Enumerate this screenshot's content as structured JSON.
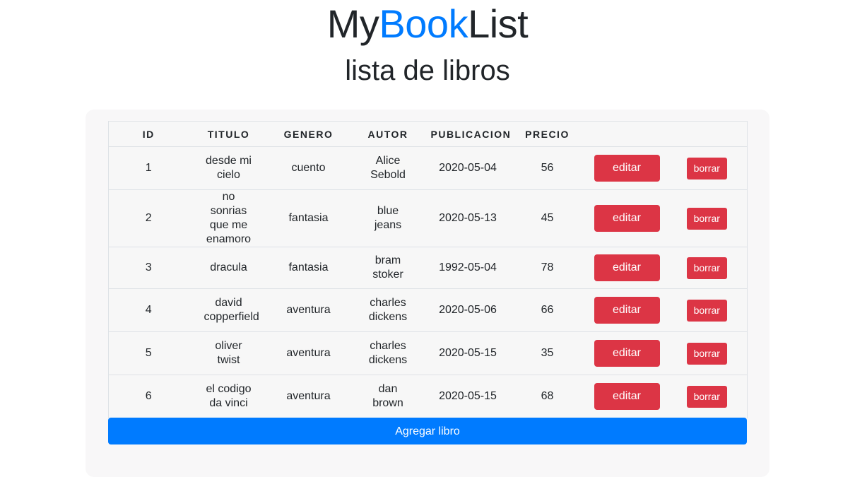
{
  "header": {
    "title_part1": "My",
    "title_part2": "Book",
    "title_part3": "List",
    "subtitle": "lista de libros",
    "accent_color": "#007bff"
  },
  "table": {
    "columns": [
      "ID",
      "TITULO",
      "GENERO",
      "AUTOR",
      "PUBLICACION",
      "PRECIO",
      "",
      ""
    ],
    "rows": [
      {
        "id": "1",
        "titulo": "desde mi cielo",
        "genero": "cuento",
        "autor": "Alice Sebold",
        "publicacion": "2020-05-04",
        "precio": "56",
        "edit_label": "editar",
        "delete_label": "borrar"
      },
      {
        "id": "2",
        "titulo": "no sonrias que me enamoro",
        "genero": "fantasia",
        "autor": "blue jeans",
        "publicacion": "2020-05-13",
        "precio": "45",
        "edit_label": "editar",
        "delete_label": "borrar"
      },
      {
        "id": "3",
        "titulo": "dracula",
        "genero": "fantasia",
        "autor": "bram stoker",
        "publicacion": "1992-05-04",
        "precio": "78",
        "edit_label": "editar",
        "delete_label": "borrar"
      },
      {
        "id": "4",
        "titulo": "david copperfield",
        "genero": "aventura",
        "autor": "charles dickens",
        "publicacion": "2020-05-06",
        "precio": "66",
        "edit_label": "editar",
        "delete_label": "borrar"
      },
      {
        "id": "5",
        "titulo": "oliver twist",
        "genero": "aventura",
        "autor": "charles dickens",
        "publicacion": "2020-05-15",
        "precio": "35",
        "edit_label": "editar",
        "delete_label": "borrar"
      },
      {
        "id": "6",
        "titulo": "el codigo da vinci",
        "genero": "aventura",
        "autor": "dan brown",
        "publicacion": "2020-05-15",
        "precio": "68",
        "edit_label": "editar",
        "delete_label": "borrar"
      }
    ],
    "danger_color": "#dc3545"
  },
  "actions": {
    "add_label": "Agregar libro"
  }
}
